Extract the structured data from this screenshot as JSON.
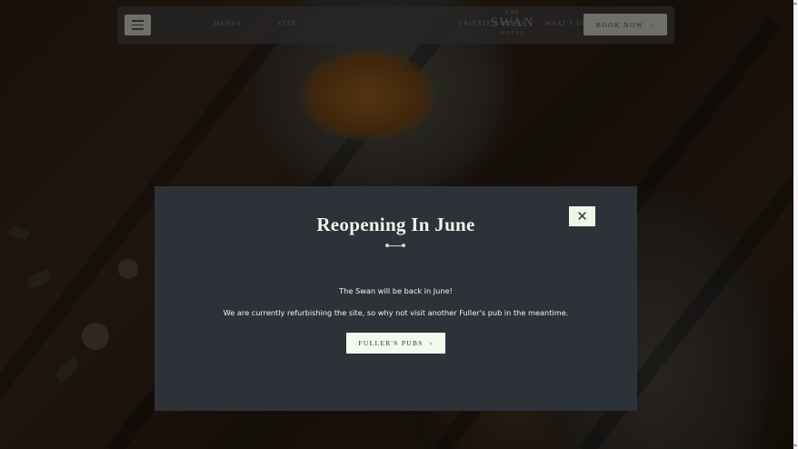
{
  "navbar": {
    "links": [
      "MENUS",
      "STAY",
      "PRIVATE EVENTS",
      "WHAT'S ON"
    ],
    "logo": {
      "top": "THE",
      "main": "SWAN",
      "bottom": "HOTEL"
    },
    "book_label": "BOOK NOW",
    "book_chevron": "›"
  },
  "modal": {
    "title": "Reopening In June",
    "message_1": "The Swan will be back in June!",
    "message_2": "We are currently refurbishing the site, so why not visit another Fuller's pub in the meantime.",
    "button_label": "FULLER'S PUBS",
    "button_chevron": "›",
    "close_glyph": "✕"
  },
  "colors": {
    "modal_bg": "#2d3239",
    "button_bg": "#f4f9ee",
    "title_color": "#f4f2ec"
  }
}
